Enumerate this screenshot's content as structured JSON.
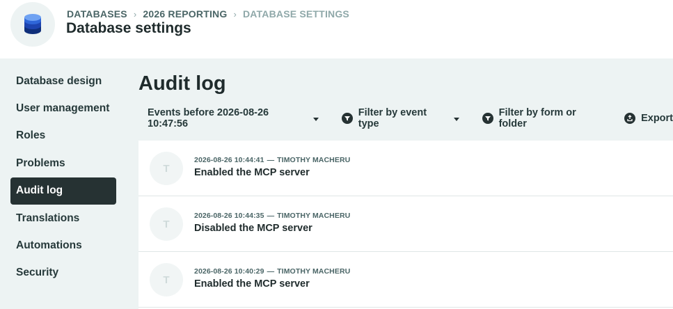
{
  "breadcrumb": {
    "items": [
      "DATABASES",
      "2026 REPORTING",
      "DATABASE SETTINGS"
    ],
    "separator": "›"
  },
  "page_title": "Database settings",
  "sidebar": {
    "items": [
      {
        "label": "Database design",
        "active": false
      },
      {
        "label": "User management",
        "active": false
      },
      {
        "label": "Roles",
        "active": false
      },
      {
        "label": "Problems",
        "active": false
      },
      {
        "label": "Audit log",
        "active": true
      },
      {
        "label": "Translations",
        "active": false
      },
      {
        "label": "Automations",
        "active": false
      },
      {
        "label": "Security",
        "active": false
      }
    ]
  },
  "content": {
    "title": "Audit log",
    "toolbar": {
      "date_filter": "Events before 2026-08-26 10:47:56",
      "event_type_filter": "Filter by event type",
      "form_folder_filter": "Filter by form or folder",
      "export": "Export"
    },
    "log_entries": [
      {
        "timestamp": "2026-08-26 10:44:41",
        "dash": "—",
        "user": "TIMOTHY MACHERU",
        "initial": "T",
        "text": "Enabled the MCP server"
      },
      {
        "timestamp": "2026-08-26 10:44:35",
        "dash": "—",
        "user": "TIMOTHY MACHERU",
        "initial": "T",
        "text": "Disabled the MCP server"
      },
      {
        "timestamp": "2026-08-26 10:40:29",
        "dash": "—",
        "user": "TIMOTHY MACHERU",
        "initial": "T",
        "text": "Enabled the MCP server"
      }
    ]
  },
  "icons": {
    "database": "database-icon",
    "filter": "filter-icon",
    "export": "export-icon",
    "caret": "caret-down-icon"
  },
  "colors": {
    "accent_dark": "#263233",
    "background": "#edf3f3",
    "database_blue": "#1f54c9"
  }
}
